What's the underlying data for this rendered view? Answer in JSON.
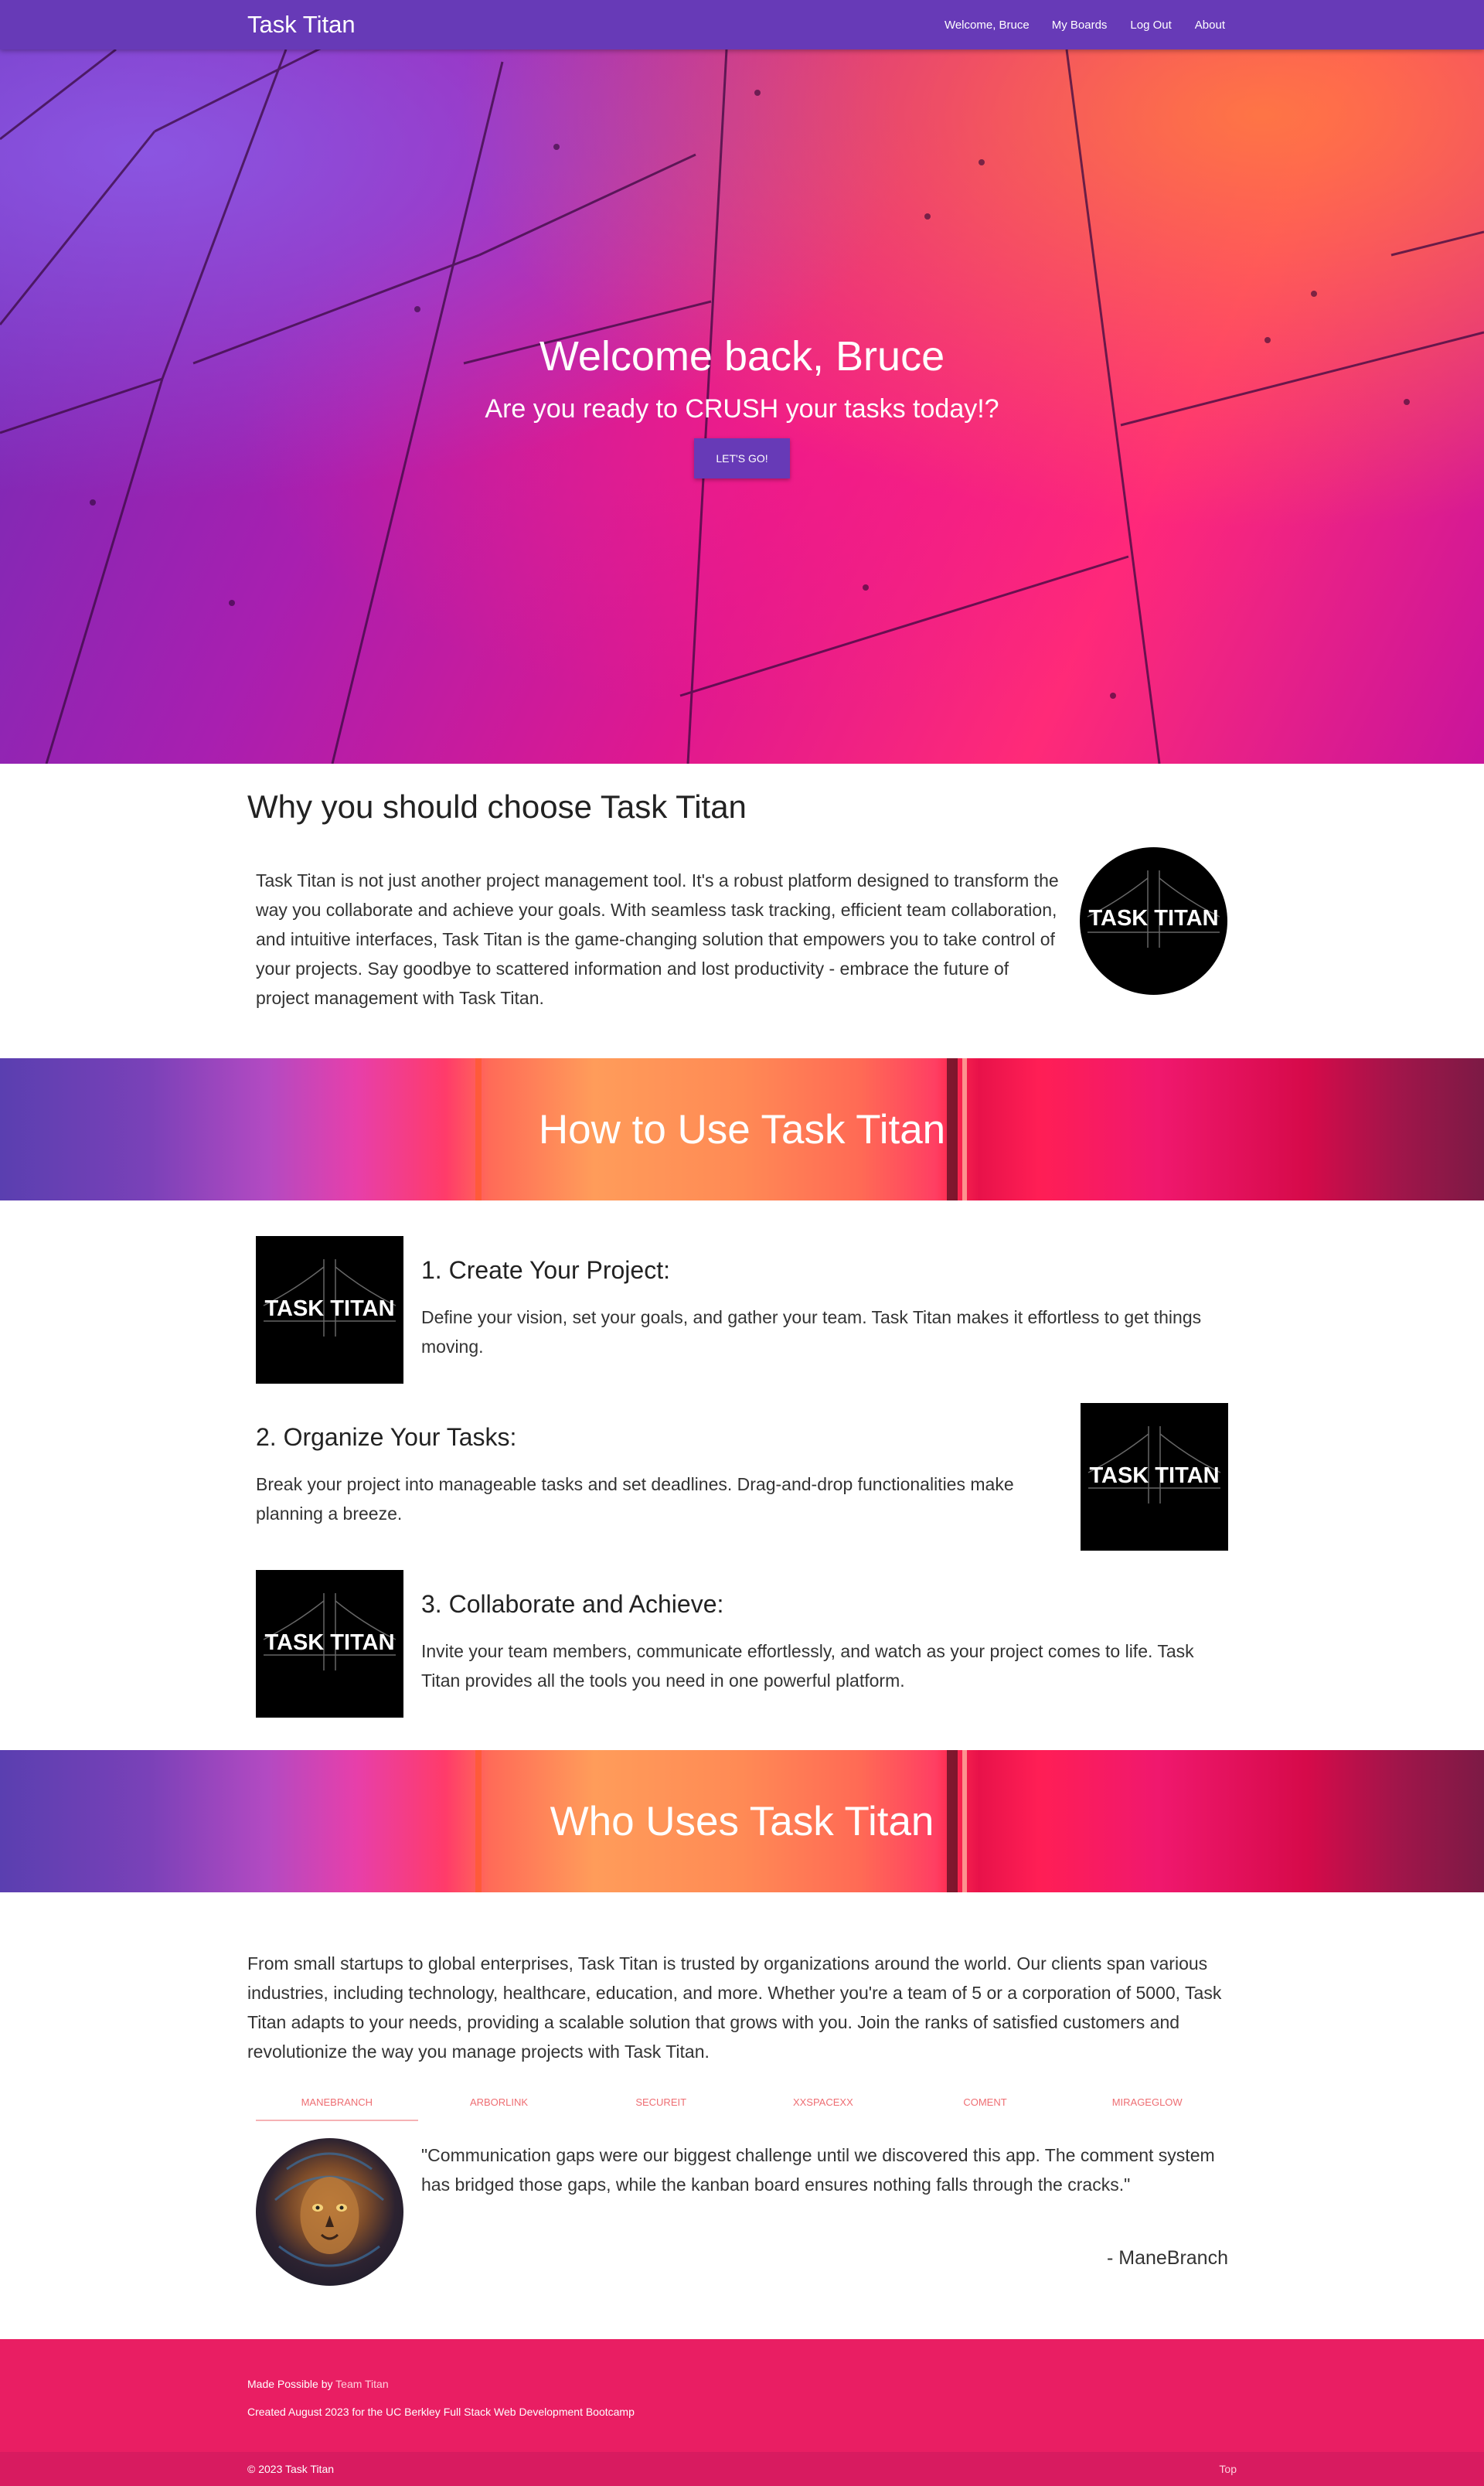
{
  "navbar": {
    "brand": "Task Titan",
    "greeting": "Welcome, Bruce",
    "links": {
      "boards": "My Boards",
      "logout": "Log Out",
      "about": "About"
    }
  },
  "hero": {
    "title": "Welcome back, Bruce",
    "subtitle": "Are you ready to CRUSH your tasks today!?",
    "button": "LET'S GO!"
  },
  "why": {
    "heading": "Why you should choose Task Titan",
    "body": "Task Titan is not just another project management tool. It's a robust platform designed to transform the way you collaborate and achieve your goals. With seamless task tracking, efficient team collaboration, and intuitive interfaces, Task Titan is the game-changing solution that empowers you to take control of your projects. Say goodbye to scattered information and lost productivity - embrace the future of project management with Task Titan.",
    "logo_text": "TASK TITAN"
  },
  "how": {
    "banner_title": "How to Use Task Titan",
    "steps": [
      {
        "title": "1. Create Your Project:",
        "text": "Define your vision, set your goals, and gather your team. Task Titan makes it effortless to get things moving.",
        "logo_text": "TASK TITAN"
      },
      {
        "title": "2. Organize Your Tasks:",
        "text": "Break your project into manageable tasks and set deadlines. Drag-and-drop functionalities make planning a breeze.",
        "logo_text": "TASK TITAN"
      },
      {
        "title": "3. Collaborate and Achieve:",
        "text": "Invite your team members, communicate effortlessly, and watch as your project comes to life. Task Titan provides all the tools you need in one powerful platform.",
        "logo_text": "TASK TITAN"
      }
    ]
  },
  "who": {
    "banner_title": "Who Uses Task Titan",
    "body": "From small startups to global enterprises, Task Titan is trusted by organizations around the world. Our clients span various industries, including technology, healthcare, education, and more. Whether you're a team of 5 or a corporation of 5000, Task Titan adapts to your needs, providing a scalable solution that grows with you. Join the ranks of satisfied customers and revolutionize the way you manage projects with Task Titan.",
    "tabs": [
      "MANEBRANCH",
      "ARBORLINK",
      "SECUREIT",
      "XXSPACEXX",
      "COMENT",
      "MIRAGEGLOW"
    ],
    "quote": "\"Communication gaps were our biggest challenge until we discovered this app. The comment system has bridged those gaps, while the kanban board ensures nothing falls through the cracks.\"",
    "author": "- ManeBranch"
  },
  "footer": {
    "made_prefix": "Made Possible by",
    "team_link": "Team Titan",
    "created": "Created August 2023 for the UC Berkley Full Stack Web Development Bootcamp",
    "copyright": "© 2023 Task Titan",
    "top_link": "Top"
  },
  "colors": {
    "primary": "#673ab7",
    "footer": "#e91e63",
    "tab_accent": "#ee6e73"
  },
  "icons": {
    "logo": "task-titan-bridge-logo",
    "avatar": "lion-avatar"
  }
}
